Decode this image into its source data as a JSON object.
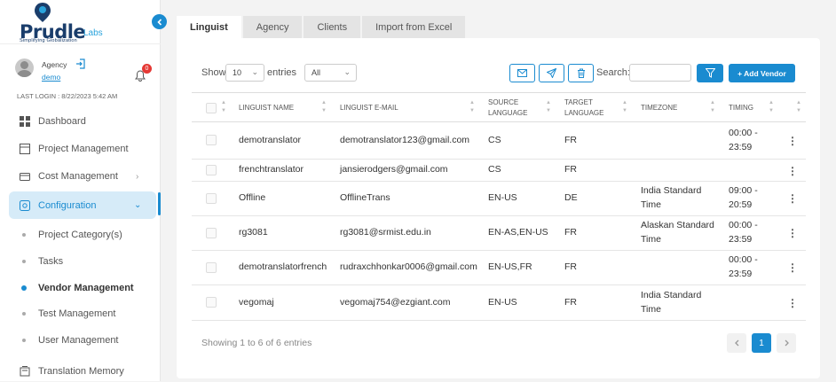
{
  "brand": {
    "name": "Prudle",
    "suffix": "Labs",
    "tagline": "Simplifying Globalization"
  },
  "user": {
    "role": "Agency",
    "name": "demo",
    "notifications": "0",
    "last_login": "LAST LOGIN : 8/22/2023 5:42 AM"
  },
  "nav": {
    "items": [
      {
        "label": "Dashboard",
        "icon": "dashboard-icon"
      },
      {
        "label": "Project Management",
        "icon": "project-icon"
      },
      {
        "label": "Cost Management",
        "icon": "cost-icon"
      },
      {
        "label": "Configuration",
        "icon": "config-icon"
      },
      {
        "label": "Translation Memory",
        "icon": "memory-icon"
      }
    ],
    "sub_items": [
      {
        "label": "Project Category(s)"
      },
      {
        "label": "Tasks"
      },
      {
        "label": "Vendor Management"
      },
      {
        "label": "Test Management"
      },
      {
        "label": "User Management"
      }
    ],
    "active": "Configuration",
    "current_sub": "Vendor Management"
  },
  "tabs": [
    {
      "label": "Linguist"
    },
    {
      "label": "Agency"
    },
    {
      "label": "Clients"
    },
    {
      "label": "Import from Excel"
    }
  ],
  "active_tab": "Linguist",
  "controls": {
    "show_label": "Show",
    "entries_value": "10",
    "entries_label": "entries",
    "filter_value": "All",
    "search_label": "Search:",
    "search_value": "",
    "add_vendor_label": "+ Add Vendor"
  },
  "table": {
    "headers": [
      {
        "label": "LINGUIST NAME"
      },
      {
        "label": "LINGUIST E-MAIL"
      },
      {
        "label": "SOURCE LANGUAGE"
      },
      {
        "label": "TARGET LANGUAGE"
      },
      {
        "label": "TIMEZONE"
      },
      {
        "label": "TIMING"
      }
    ],
    "rows": [
      {
        "name": "demotranslator",
        "email": "demotranslator123@gmail.com",
        "source": "CS",
        "target": "FR",
        "timezone": "",
        "timing": "00:00 - 23:59"
      },
      {
        "name": "frenchtranslator",
        "email": "jansierodgers@gmail.com",
        "source": "CS",
        "target": "FR",
        "timezone": "",
        "timing": ""
      },
      {
        "name": "Offline",
        "email": "OfflineTrans",
        "source": "EN-US",
        "target": "DE",
        "timezone": "India Standard Time",
        "timing": "09:00 - 20:59"
      },
      {
        "name": "rg3081",
        "email": "rg3081@srmist.edu.in",
        "source": "EN-AS,EN-US",
        "target": "FR",
        "timezone": "Alaskan Standard Time",
        "timing": "00:00 - 23:59"
      },
      {
        "name": "demotranslatorfrench",
        "email": "rudraxchhonkar0006@gmail.com",
        "source": "EN-US,FR",
        "target": "FR",
        "timezone": "",
        "timing": "00:00 - 23:59"
      },
      {
        "name": "vegomaj",
        "email": "vegomaj754@ezgiant.com",
        "source": "EN-US",
        "target": "FR",
        "timezone": "India Standard Time",
        "timing": ""
      }
    ]
  },
  "footer": {
    "summary": "Showing 1 to 6 of 6 entries",
    "current_page": "1"
  },
  "colors": {
    "accent": "#1a8bd0",
    "active_bg": "#d6ebf8",
    "badge": "#e53935",
    "brand": "#1a3d6b"
  }
}
